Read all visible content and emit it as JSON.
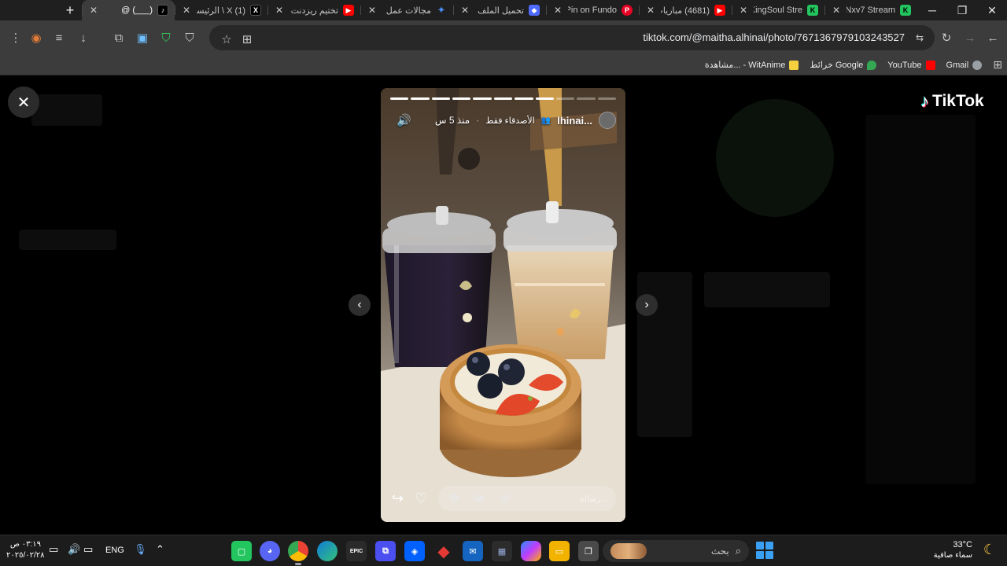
{
  "window": {
    "close": "✕",
    "restore": "❐",
    "minimize": "─",
    "new_tab": "+"
  },
  "tabs": [
    {
      "title": "Nxv7 Stream",
      "favicon": "K",
      "favicon_color": "#22c55e",
      "close": "✕"
    },
    {
      "title": "KingSoul Stre",
      "favicon": "K",
      "favicon_color": "#22c55e",
      "close": "✕"
    },
    {
      "title": "(4681) مباريات",
      "favicon": "▶",
      "favicon_color": "#ff0000",
      "close": "✕"
    },
    {
      "title": "Pin on Fundo",
      "favicon": "P",
      "favicon_color": "#e60023",
      "close": "✕"
    },
    {
      "title": "تحميل الملف",
      "favicon": "◆",
      "favicon_color": "#4f6bff",
      "close": "✕"
    },
    {
      "title": "مجالات عمل",
      "favicon": "✦",
      "favicon_color": "#4c8df6",
      "close": "✕"
    },
    {
      "title": "تختيم ريزدنت",
      "favicon": "▶",
      "favicon_color": "#ff0000",
      "close": "✕"
    },
    {
      "title": "(1) X \\ الرئيسة",
      "favicon": "X",
      "favicon_color": "#000000",
      "close": "✕"
    },
    {
      "title": "(___) @",
      "favicon": "♪",
      "favicon_color": "#000000",
      "close": "✕",
      "active": true
    }
  ],
  "toolbar": {
    "url": "tiktok.com/@maitha.alhinai/photo/7671367979103243527",
    "icons": {
      "forward": "→",
      "back": "←",
      "reload": "↻",
      "menu": "⋮",
      "extension": "◉",
      "media": "≡",
      "download": "↓",
      "extensions": "⧉",
      "ext_a": "▣",
      "ext_b": "⛉",
      "ext_c": "⛉",
      "star": "☆",
      "translate": "⊞",
      "tune": "⇆"
    }
  },
  "bookmarks": [
    {
      "label": "Gmail",
      "color": "#9aa0a6"
    },
    {
      "label": "YouTube",
      "color": "#ff0000"
    },
    {
      "label": "خرائط Google",
      "color": "#34a853"
    },
    {
      "label": "مشاهدة... - WitAnime",
      "color": "#f4d03f"
    }
  ],
  "viewer": {
    "close": "✕",
    "logo_note": "♪",
    "logo_text": "TikTok",
    "prev": "‹",
    "next": "›"
  },
  "story": {
    "username": "lhinai...",
    "audience": "الأصدقاء فقط",
    "time": "منذ 5 س",
    "progress_total": 11,
    "progress_done": 8,
    "sound": "🔊",
    "share": "↪",
    "like": "♡",
    "reactions": [
      "😳",
      "😂",
      "😍"
    ],
    "reply_placeholder": "رسالة..."
  },
  "taskbar": {
    "time": "٠٣:١٩ ص",
    "date": "٢٠٢٥/٠٢/٢٨",
    "lang": "ENG",
    "search": "بحث",
    "weather_temp": "33°C",
    "weather_text": "سماء صافية",
    "tray": {
      "chevron": "⌃",
      "mic": "🎙",
      "display": "▭",
      "volume": "🔊",
      "battery": "▭"
    }
  }
}
